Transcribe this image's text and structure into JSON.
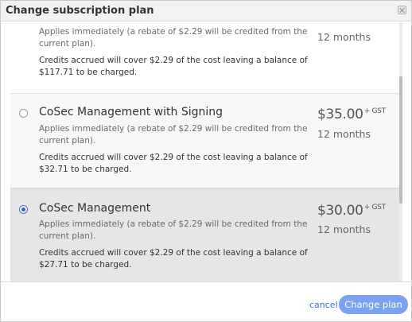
{
  "dialog": {
    "title": "Change subscription plan"
  },
  "plans": [
    {
      "name": "",
      "price": "",
      "price_suffix": "",
      "term": "12 months",
      "description": "Applies immediately (a rebate of $2.29 will be credited from the current plan).",
      "credit_note": "Credits accrued will cover $2.29 of the cost leaving a balance of $117.71 to be charged.",
      "selected": false
    },
    {
      "name": "CoSec Management with Signing",
      "price": "$35.00",
      "price_suffix": "+ GST",
      "term": "12 months",
      "description": "Applies immediately (a rebate of $2.29 will be credited from the current plan).",
      "credit_note": "Credits accrued will cover $2.29 of the cost leaving a balance of $32.71 to be charged.",
      "selected": false
    },
    {
      "name": "CoSec Management",
      "price": "$30.00",
      "price_suffix": "+ GST",
      "term": "12 months",
      "description": "Applies immediately (a rebate of $2.29 will be credited from the current plan).",
      "credit_note": "Credits accrued will cover $2.29 of the cost leaving a balance of $27.71 to be charged.",
      "selected": true
    }
  ],
  "footer": {
    "cancel_label": "cancel",
    "submit_label": "Change plan"
  },
  "colors": {
    "accent": "#3a55e0",
    "button": "#7aa2f0",
    "link": "#3e6fd6"
  }
}
